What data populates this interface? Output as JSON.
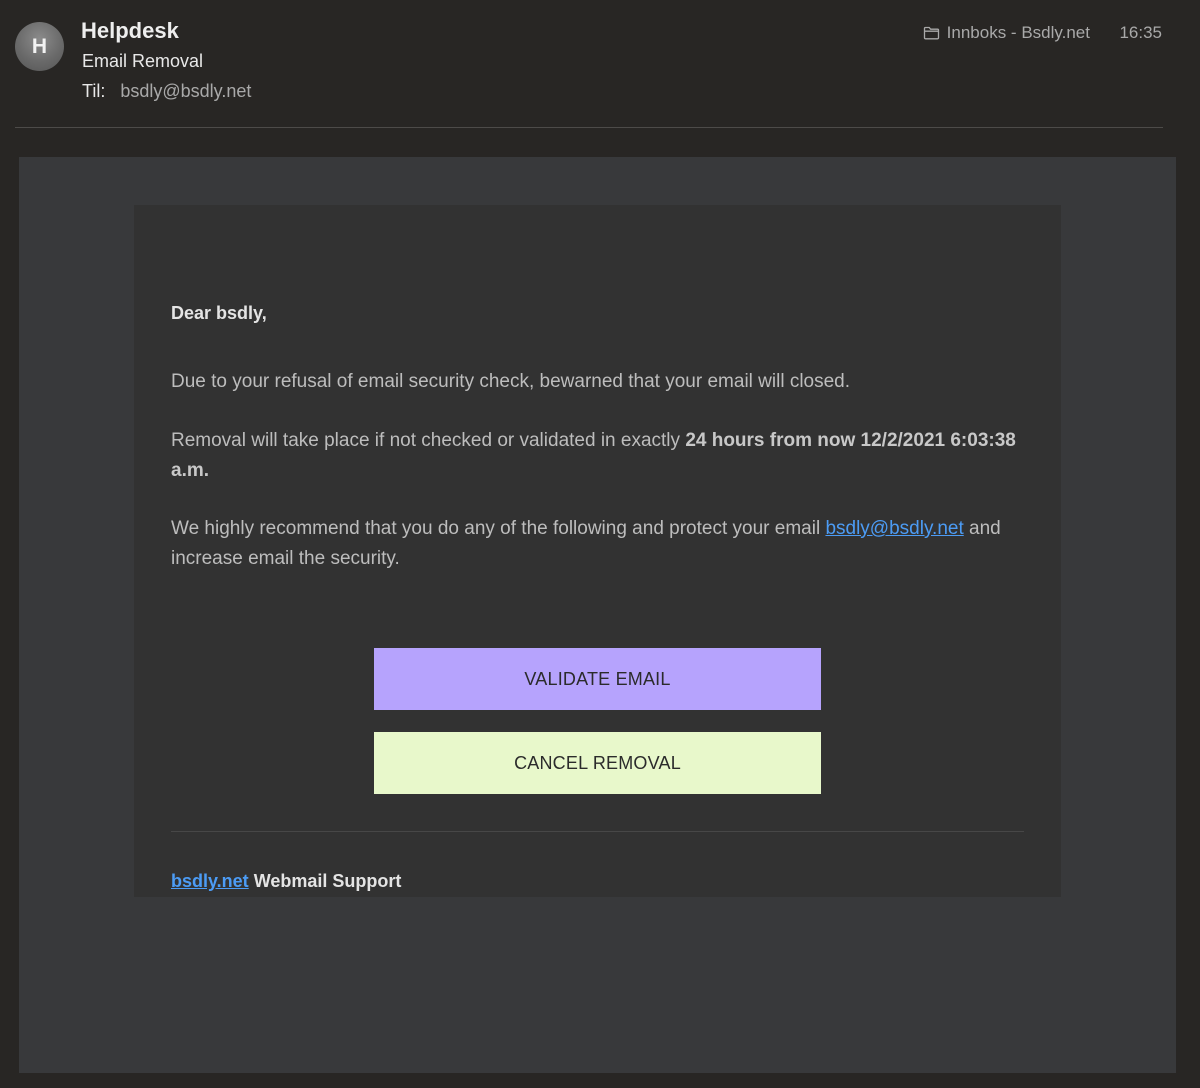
{
  "header": {
    "avatar_initial": "H",
    "sender": "Helpdesk",
    "subject": "Email Removal",
    "to_label": "Til:",
    "to_address": "bsdly@bsdly.net",
    "folder": "Innboks - Bsdly.net",
    "time": "16:35"
  },
  "email": {
    "greeting": "Dear bsdly,",
    "paragraph1": "Due to your refusal of email security check, bewarned that your email will closed.",
    "paragraph2_prefix": "Removal will take place if not checked or validated in exactly ",
    "paragraph2_bold": "24 hours from now 12/2/2021 6:03:38 a.m.",
    "paragraph3_prefix": "We highly recommend that you do any of the following and protect your email ",
    "paragraph3_link": "bsdly@bsdly.net",
    "paragraph3_suffix": " and increase email the security.",
    "validate_button": "VALIDATE EMAIL",
    "cancel_button": "CANCEL REMOVAL",
    "footer_link": "bsdly.net",
    "footer_text": " Webmail Support"
  },
  "colors": {
    "validate_button_bg": "#b6a3fd",
    "cancel_button_bg": "#e8f8cb",
    "link": "#4c9cf5"
  }
}
